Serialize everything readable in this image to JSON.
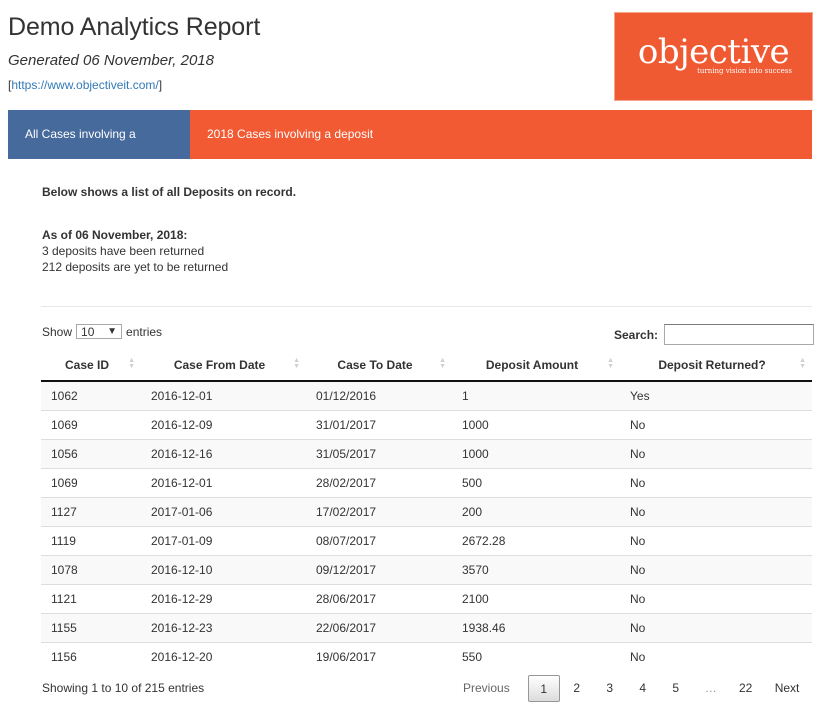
{
  "header": {
    "title": "Demo Analytics Report",
    "generated": "Generated 06 November, 2018",
    "link_open": "[",
    "link_text": "https://www.objectiveit.com/",
    "link_close": "]"
  },
  "logo": {
    "word": "objective",
    "tagline": "turning vision into success",
    "color": "#f05a32"
  },
  "tabs": [
    {
      "label": "All Cases involving a deposit",
      "active": true,
      "color": "#466a9b"
    },
    {
      "label": "2018 Cases involving a deposit",
      "active": false,
      "color": "#f15a32"
    }
  ],
  "summary": {
    "intro": "Below shows a list of all Deposits on record.",
    "as_of": "As of 06 November, 2018:",
    "returned": "3 deposits have been returned",
    "outstanding": "212 deposits are yet to be returned"
  },
  "controls": {
    "show_label": "Show",
    "entries_value": "10",
    "entries_label": "entries",
    "search_label": "Search:",
    "search_value": ""
  },
  "table": {
    "columns": [
      "Case ID",
      "Case From Date",
      "Case To Date",
      "Deposit Amount",
      "Deposit Returned?"
    ],
    "rows": [
      [
        "1062",
        "2016-12-01",
        "01/12/2016",
        "1",
        "Yes"
      ],
      [
        "1069",
        "2016-12-09",
        "31/01/2017",
        "1000",
        "No"
      ],
      [
        "1056",
        "2016-12-16",
        "31/05/2017",
        "1000",
        "No"
      ],
      [
        "1069",
        "2016-12-01",
        "28/02/2017",
        "500",
        "No"
      ],
      [
        "1127",
        "2017-01-06",
        "17/02/2017",
        "200",
        "No"
      ],
      [
        "1119",
        "2017-01-09",
        "08/07/2017",
        "2672.28",
        "No"
      ],
      [
        "1078",
        "2016-12-10",
        "09/12/2017",
        "3570",
        "No"
      ],
      [
        "1121",
        "2016-12-29",
        "28/06/2017",
        "2100",
        "No"
      ],
      [
        "1155",
        "2016-12-23",
        "22/06/2017",
        "1938.46",
        "No"
      ],
      [
        "1156",
        "2016-12-20",
        "19/06/2017",
        "550",
        "No"
      ]
    ]
  },
  "footer": {
    "info": "Showing 1 to 10 of 215 entries",
    "pagination": {
      "previous": "Previous",
      "pages": [
        "1",
        "2",
        "3",
        "4",
        "5"
      ],
      "ellipsis": "…",
      "last": "22",
      "next": "Next",
      "current": "1"
    }
  }
}
